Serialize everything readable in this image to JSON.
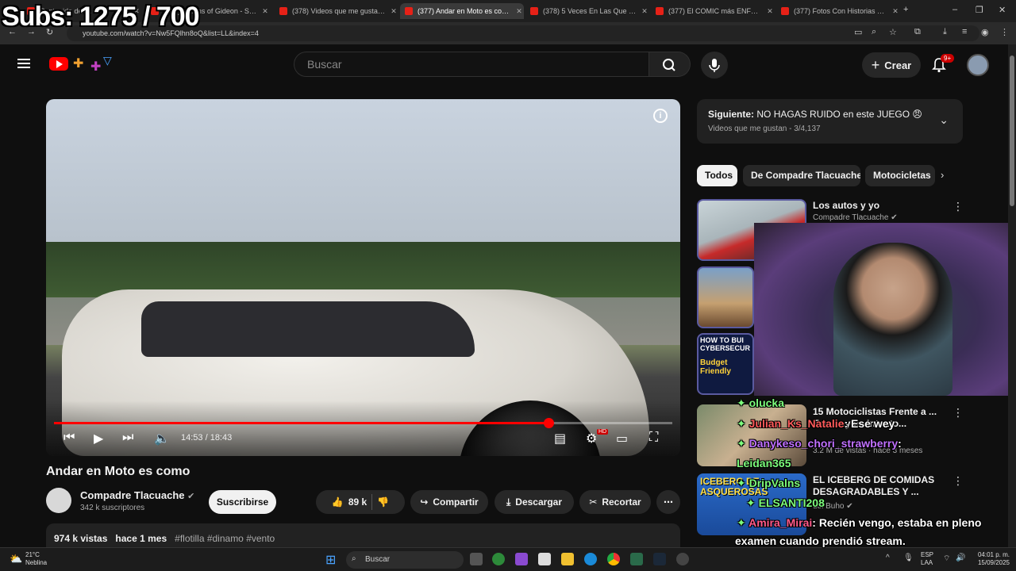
{
  "overlay": {
    "subs": "Subs: 1275 / 700"
  },
  "browser": {
    "tabs": [
      {
        "title": "Contenido del ..."
      },
      {
        "title": "(377) Visions of Gideon - Sufjan"
      },
      {
        "title": "(378) Videos que me gustan - Y"
      },
      {
        "title": "(377) Andar en Moto es como"
      },
      {
        "title": "(378) 5 Veces En Las Que Strea"
      },
      {
        "title": "(377) El COMIC más ENFERMO"
      },
      {
        "title": "(377) Fotos Con Historias Pertu"
      }
    ],
    "url": "youtube.com/watch?v=Nw5FQlhn8oQ&list=LL&index=4"
  },
  "header": {
    "search_placeholder": "Buscar",
    "create_label": "Crear",
    "notifications": "9+"
  },
  "player": {
    "time": "14:53 / 18:43",
    "progress": 0.8,
    "hd_badge": "HD"
  },
  "video": {
    "title": "Andar en Moto es como",
    "channel": "Compadre Tlacuache",
    "subscribers": "342 k suscriptores",
    "subscribe": "Suscribirse",
    "likes": "89 k",
    "share": "Compartir",
    "download": "Descargar",
    "clip": "Recortar",
    "views": "974 k vistas",
    "ago": "hace 1 mes",
    "tags": "#flotilla #dinamo #vento"
  },
  "sidebar": {
    "next_label": "Siguiente:",
    "next_title": "NO HAGAS RUIDO en este JUEGO 😠",
    "next_playlist": "Videos que me gustan - 3/4,137",
    "chips": [
      "Todos",
      "De Compadre Tlacuache",
      "Motocicletas"
    ],
    "recos": [
      {
        "title": "Los autos y yo",
        "meta": "Compadre Tlacuache ✔"
      },
      {
        "title": "15 Motociclistas Frente a ... Ese weyos, Intento...",
        "meta": "3.2 M de vistas · hace 3 meses"
      },
      {
        "title": "EL ICEBERG DE COMIDAS DESAGRADABLES Y ...",
        "meta": "del Buho ✔"
      }
    ],
    "thumb_text": {
      "howto": "HOW TO BUI CYBERSECUR",
      "budget": "Budget Friendly",
      "iceberg": "ICEBERG DE ASQUEROSAS"
    }
  },
  "chat": [
    {
      "user": "olucka",
      "msg": ""
    },
    {
      "user": "Julian_Ks_Natalie",
      "msg": ": Ese wey"
    },
    {
      "user": "Danykeso_chori_strawberry",
      "msg": ":"
    },
    {
      "user": "Leidan365",
      "msg": ""
    },
    {
      "user": "DripValns",
      "msg": ""
    },
    {
      "user": "ELSANTI208",
      "msg": ""
    },
    {
      "user": "Amira_Mirai",
      "msg": ": Recién vengo, estaba en pleno"
    },
    {
      "user": "",
      "msg": "examen cuando prendió stream."
    }
  ],
  "taskbar": {
    "temp": "21°C",
    "weather": "Neblina",
    "search": "Buscar",
    "lang1": "ESP",
    "lang2": "LAA",
    "time": "04:01 p. m.",
    "date": "15/09/2025"
  }
}
